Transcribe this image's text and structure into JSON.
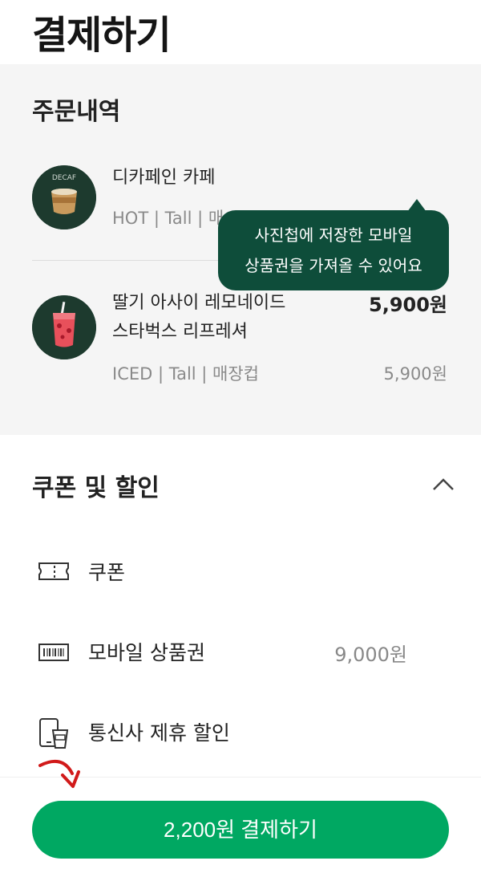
{
  "page": {
    "title": "결제하기"
  },
  "order": {
    "title": "주문내역",
    "items": [
      {
        "name_line1": "디카페인 카페",
        "name_line2": "",
        "options": "HOT | Tall | 매",
        "price_top": "",
        "price_bottom": "",
        "thumb_badge": "DECAF"
      },
      {
        "name_line1": "딸기 아사이 레모네이드",
        "name_line2": "스타벅스 리프레셔",
        "options": "ICED | Tall | 매장컵",
        "price_top": "5,900원",
        "price_bottom": "5,900원"
      }
    ]
  },
  "tooltip": {
    "line1": "사진첩에 저장한 모바일",
    "line2": "상품권을 가져올 수 있어요"
  },
  "discount": {
    "title": "쿠폰 및 할인",
    "rows": [
      {
        "label": "쿠폰",
        "value": ""
      },
      {
        "label": "모바일 상품권",
        "value": "9,000원"
      },
      {
        "label": "통신사 제휴 할인",
        "value": ""
      }
    ]
  },
  "pay_button": {
    "label": "2,200원 결제하기"
  },
  "colors": {
    "brand_green": "#00a862",
    "tooltip_green": "#0e4d3a",
    "hint_arrow": "#d11a1a"
  }
}
